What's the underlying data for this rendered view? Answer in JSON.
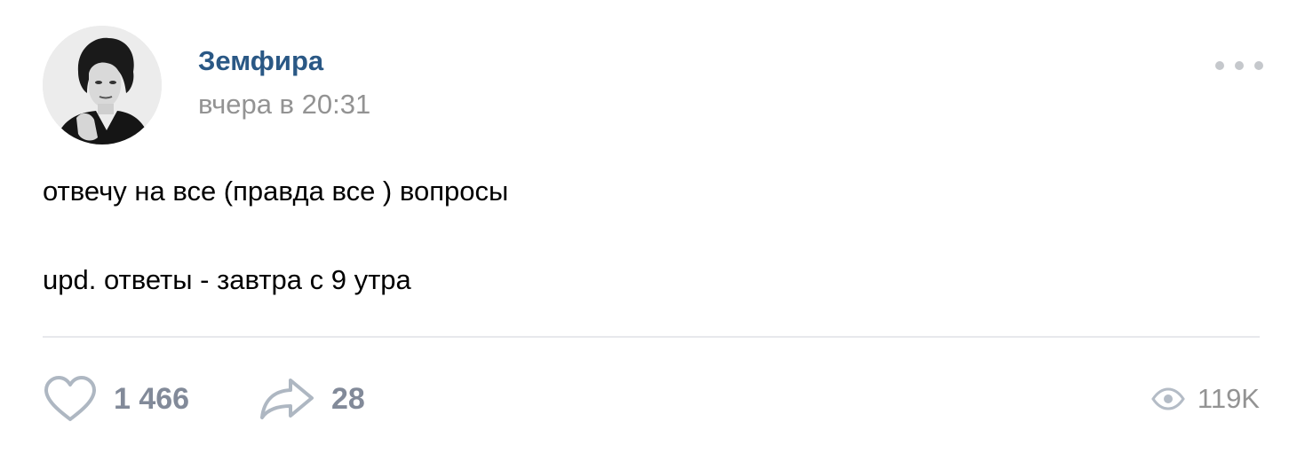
{
  "post": {
    "author": "Земфира",
    "time": "вчера в 20:31",
    "text_line_1": "отвечу на все (правда все ) вопросы",
    "text_line_2": "upd. ответы - завтра с 9 утра",
    "likes": "1 466",
    "shares": "28",
    "views": "119K"
  },
  "icons": {
    "avatar": "profile-photo",
    "more": "more-dots-icon",
    "like": "heart-icon",
    "share": "share-arrow-icon",
    "views": "eye-icon"
  },
  "colors": {
    "author": "#2a5885",
    "meta": "#939393",
    "action": "#828a99",
    "divider": "#e7e8ec"
  }
}
